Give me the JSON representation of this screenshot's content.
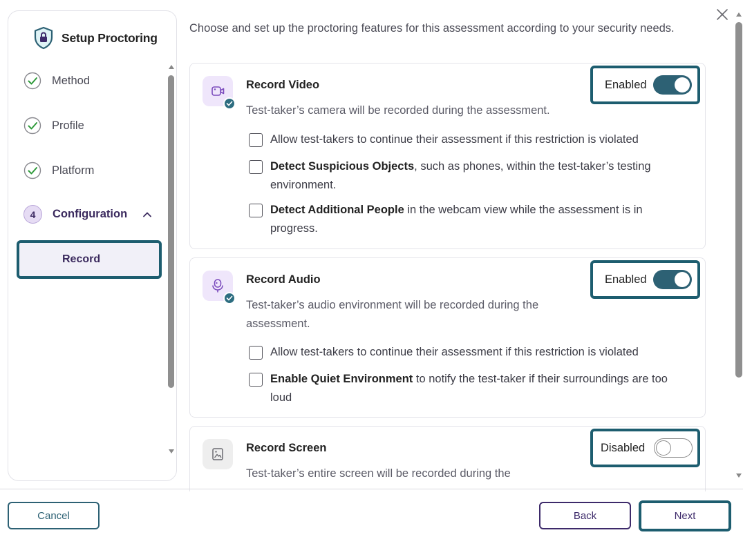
{
  "sidebar": {
    "title": "Setup Proctoring",
    "steps": [
      {
        "label": "Method",
        "state": "complete"
      },
      {
        "label": "Profile",
        "state": "complete"
      },
      {
        "label": "Platform",
        "state": "complete"
      },
      {
        "number": "4",
        "label": "Configuration",
        "state": "active",
        "expanded": true
      }
    ],
    "sub_items": [
      {
        "label": "Record",
        "selected": true
      }
    ]
  },
  "main": {
    "intro": "Choose and set up the proctoring features for this assessment according to your security needs.",
    "cards": [
      {
        "icon": "video-camera-icon",
        "title": "Record Video",
        "description": "Test-taker’s camera will be recorded during the assessment.",
        "toggle_label": "Enabled",
        "enabled": true,
        "options": [
          {
            "bold": "",
            "text": "Allow test-takers to continue their assessment if this restriction is violated",
            "checked": false
          },
          {
            "bold": "Detect Suspicious Objects",
            "text": ", such as phones, within the test-taker’s testing environment.",
            "checked": false
          },
          {
            "bold": "Detect Additional People",
            "text": " in the webcam view while the assessment is in progress.",
            "checked": false
          }
        ]
      },
      {
        "icon": "microphone-icon",
        "title": "Record Audio",
        "description": "Test-taker’s audio environment will be recorded during the assessment.",
        "toggle_label": "Enabled",
        "enabled": true,
        "options": [
          {
            "bold": "",
            "text": "Allow test-takers to continue their assessment if this restriction is violated",
            "checked": false
          },
          {
            "bold": "Enable Quiet Environment",
            "text": " to notify the test-taker if their surroundings are too loud",
            "checked": false
          }
        ]
      },
      {
        "icon": "screen-icon",
        "title": "Record Screen",
        "description": "Test-taker’s entire screen will be recorded during the",
        "toggle_label": "Disabled",
        "enabled": false
      }
    ]
  },
  "footer": {
    "cancel_label": "Cancel",
    "back_label": "Back",
    "next_label": "Next"
  },
  "colors": {
    "teal": "#2d6174",
    "focus_ring": "#1d5d6f",
    "purple": "#3d2a6a",
    "icon_bg": "#efe6fb"
  }
}
